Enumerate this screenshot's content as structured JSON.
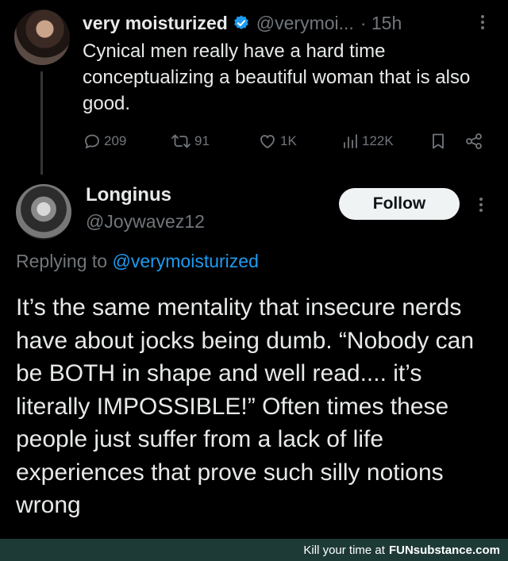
{
  "parent_tweet": {
    "display_name": "very moisturized",
    "handle": "@verymoi...",
    "time": "· 15h",
    "text": "Cynical men really have a hard time conceptualizing a beautiful woman that is also good.",
    "actions": {
      "replies": "209",
      "retweets": "91",
      "likes": "1K",
      "views": "122K"
    }
  },
  "reply_tweet": {
    "display_name": "Longinus",
    "handle": "@Joywavez12",
    "follow_label": "Follow",
    "replying_prefix": "Replying to",
    "replying_to": "@verymoisturized",
    "text": "It’s the same mentality that insecure nerds have about jocks being dumb. “Nobody can be BOTH in shape and well read.... it’s literally IMPOSSIBLE!” Often times these people just suffer from a lack of life experiences that prove such silly notions wrong"
  },
  "footer": {
    "prefix": "Kill your time at",
    "brand_fun": "FUN",
    "brand_sub": "substance.com"
  },
  "colors": {
    "background": "#000000",
    "text": "#e7e9ea",
    "muted": "#71767b",
    "accent": "#1d9bf0",
    "footer_bg": "#1e3a37"
  },
  "icons": [
    "reply-icon",
    "retweet-icon",
    "like-icon",
    "views-icon",
    "bookmark-icon",
    "share-icon",
    "verified-icon",
    "more-icon"
  ]
}
